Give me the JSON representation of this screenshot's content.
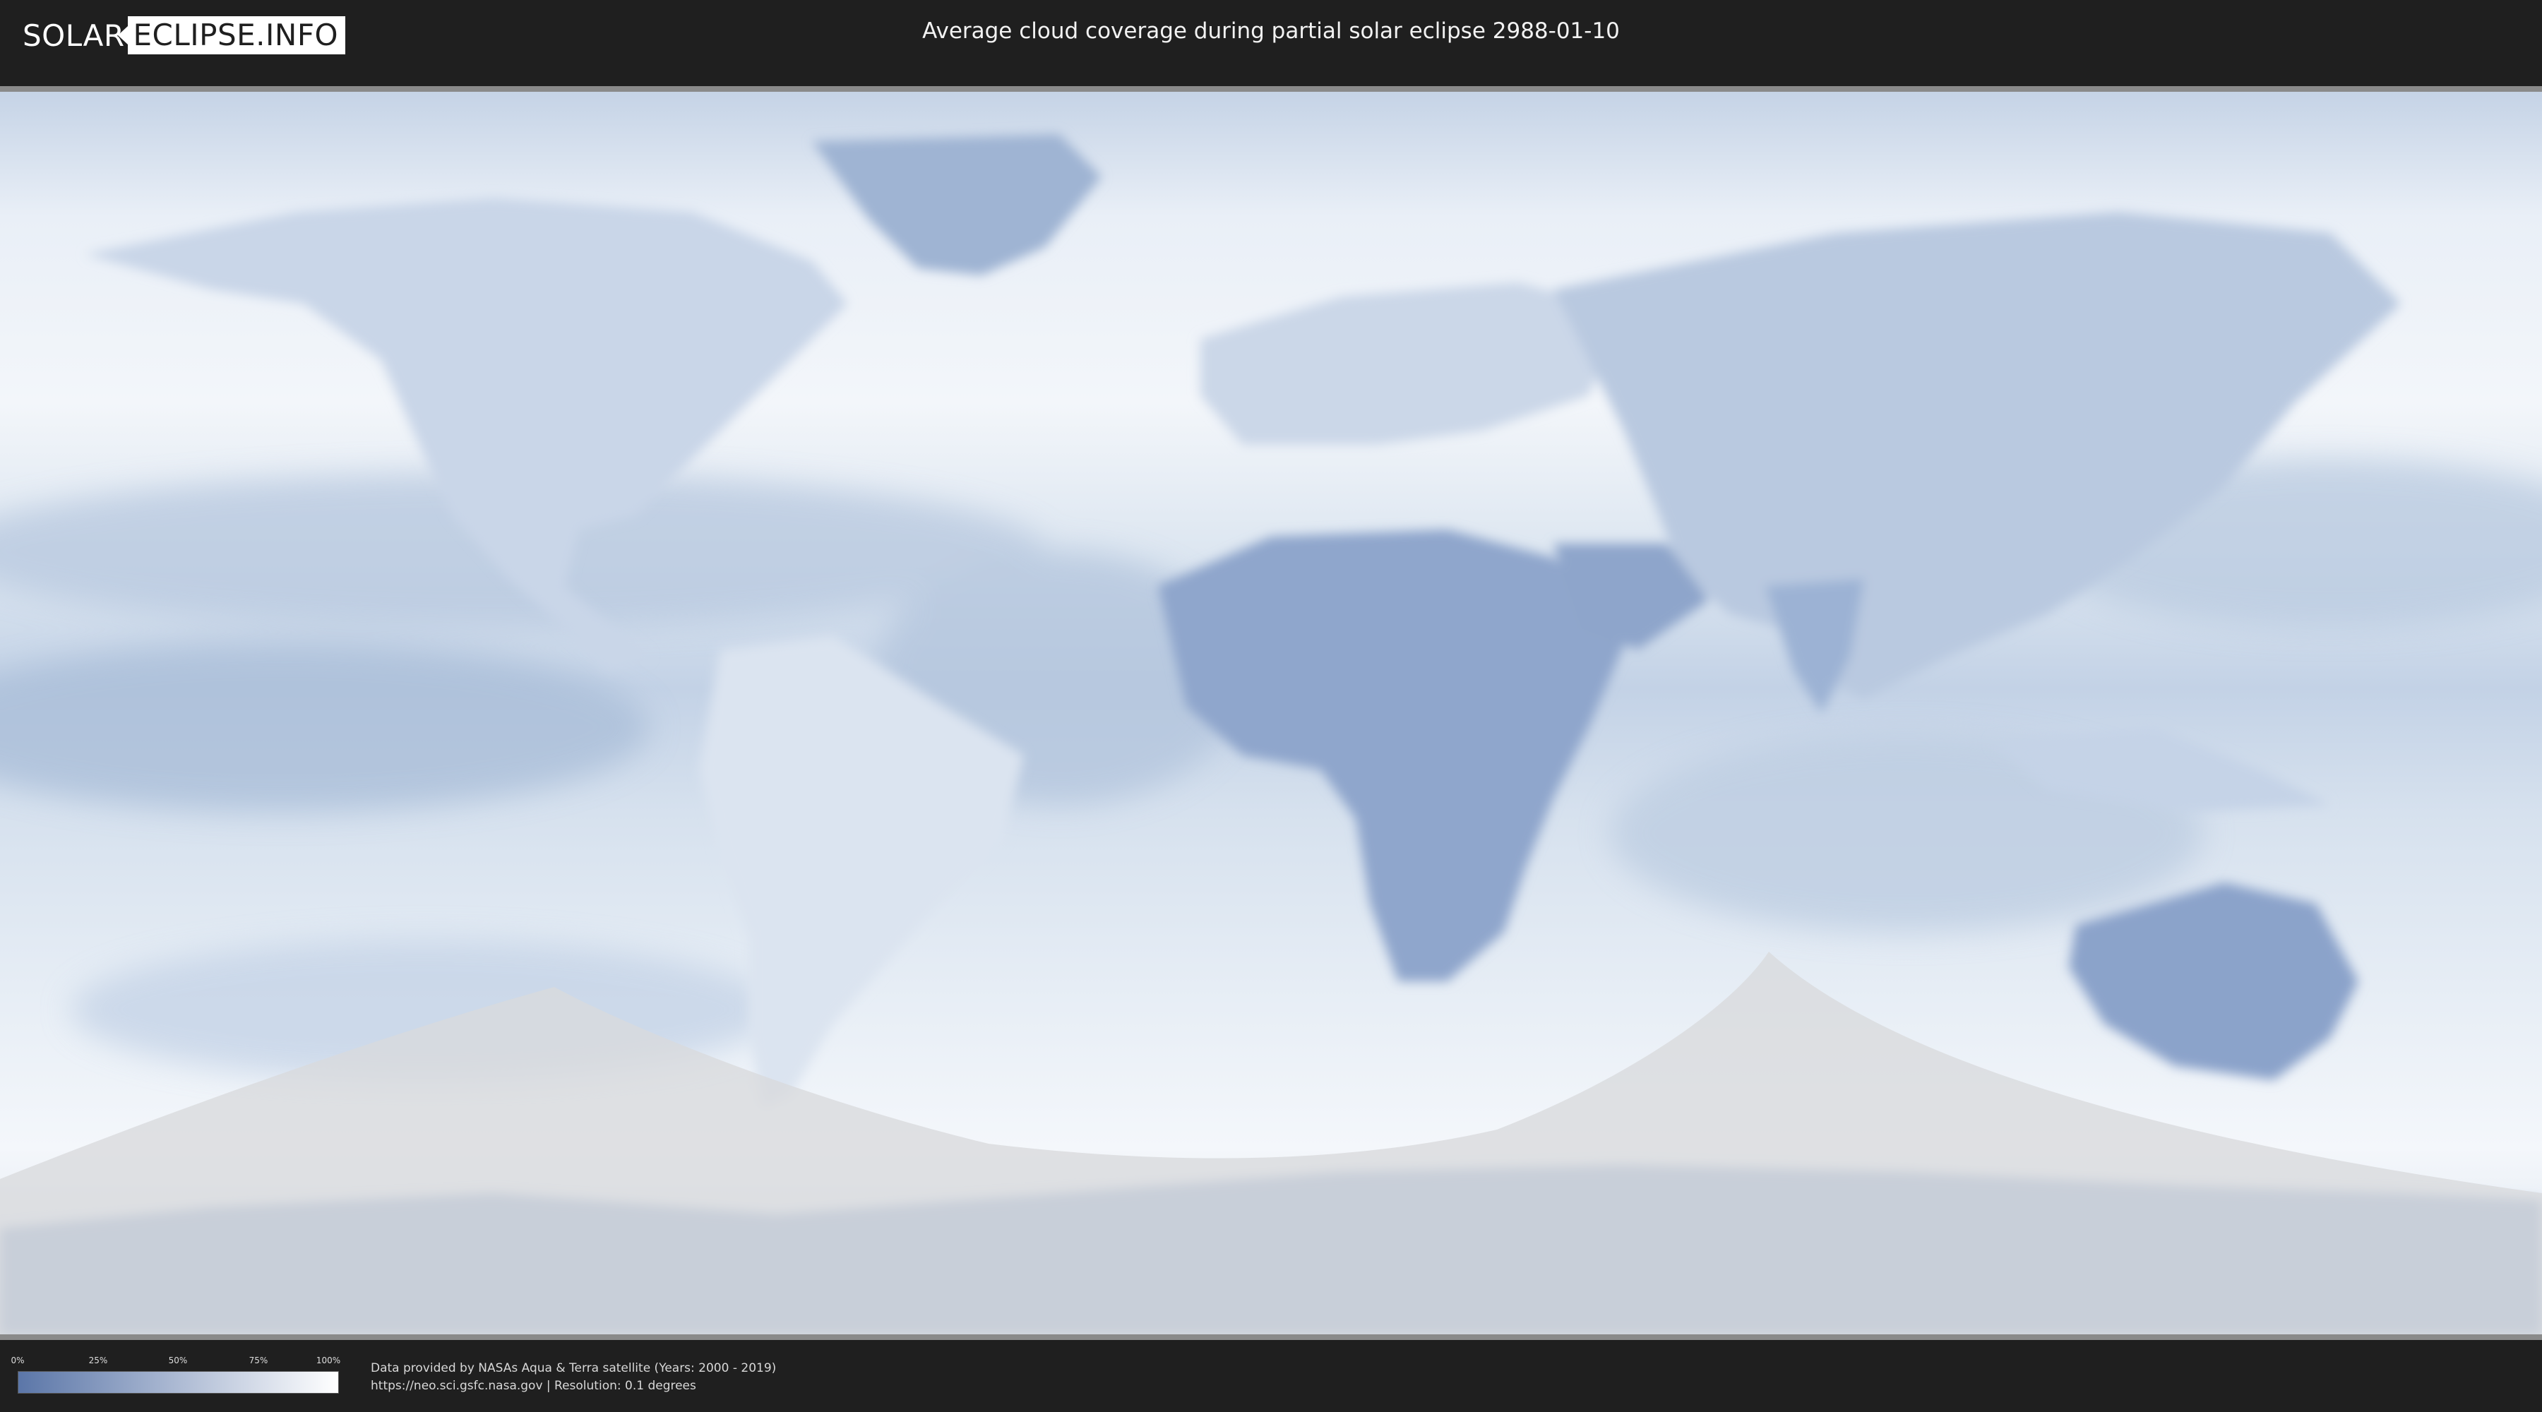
{
  "header": {
    "logo_left": "SOLAR",
    "logo_right": "ECLIPSE.INFO",
    "title": "Average cloud coverage during partial solar eclipse 2988-01-10"
  },
  "legend": {
    "ticks": [
      "0%",
      "25%",
      "50%",
      "75%",
      "100%"
    ],
    "color_low": "#5b76a8",
    "color_high": "#ffffff"
  },
  "credits": {
    "line1": "Data provided by NASAs Aqua & Terra satellite (Years: 2000 - 2019)",
    "line2": "https://neo.sci.gsfc.nasa.gov | Resolution: 0.1 degrees"
  },
  "colors": {
    "background": "#1f1f1f",
    "ocean_cloud_light": "#eef3f9",
    "cloud_blue": "#8ea6c9",
    "land_dark": "#6f88b5",
    "eclipse_overlay": "#d9dadc"
  }
}
